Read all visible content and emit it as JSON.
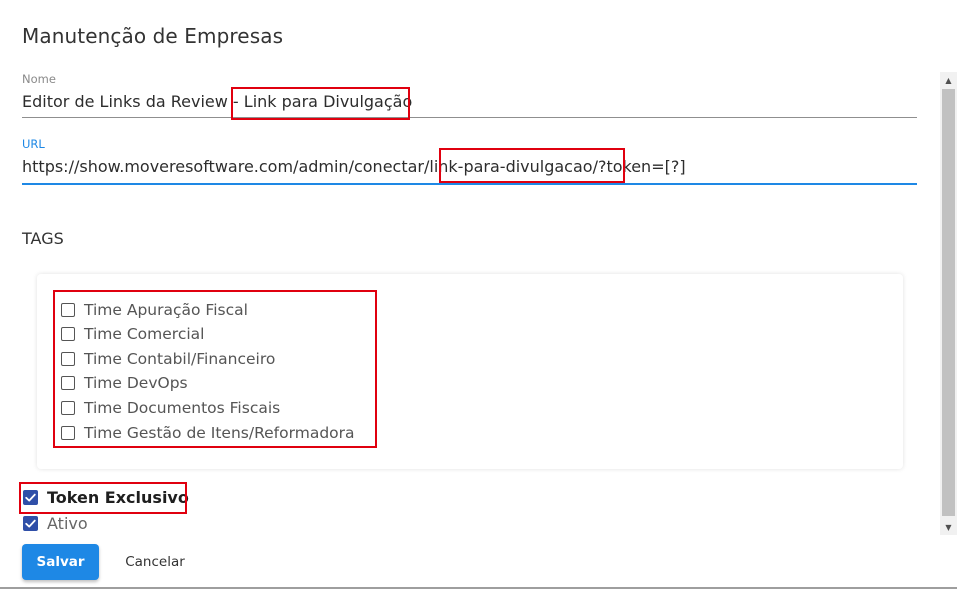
{
  "dialog": {
    "title": "Manutenção de Empresas"
  },
  "nome": {
    "label": "Nome",
    "value": "Editor de Links da Review - Link para Divulgação"
  },
  "url": {
    "label": "URL",
    "value": "https://show.moveresoftware.com/admin/conectar/link-para-divulgacao/?token=[?]"
  },
  "tags": {
    "title": "TAGS",
    "items": [
      {
        "label": "Time Apuração Fiscal",
        "checked": false
      },
      {
        "label": "Time Comercial",
        "checked": false
      },
      {
        "label": "Time Contabil/Financeiro",
        "checked": false
      },
      {
        "label": "Time DevOps",
        "checked": false
      },
      {
        "label": "Time Documentos Fiscais",
        "checked": false
      },
      {
        "label": "Time Gestão de Itens/Reformadora",
        "checked": false
      }
    ]
  },
  "options": {
    "token_exclusivo": {
      "label": "Token Exclusivo",
      "checked": true
    },
    "ativo": {
      "label": "Ativo",
      "checked": true
    }
  },
  "actions": {
    "save_label": "Salvar",
    "cancel_label": "Cancelar"
  },
  "colors": {
    "accent": "#1e88e5",
    "checkbox_checked": "#2f4fa8",
    "highlight_box": "#e0000f"
  }
}
